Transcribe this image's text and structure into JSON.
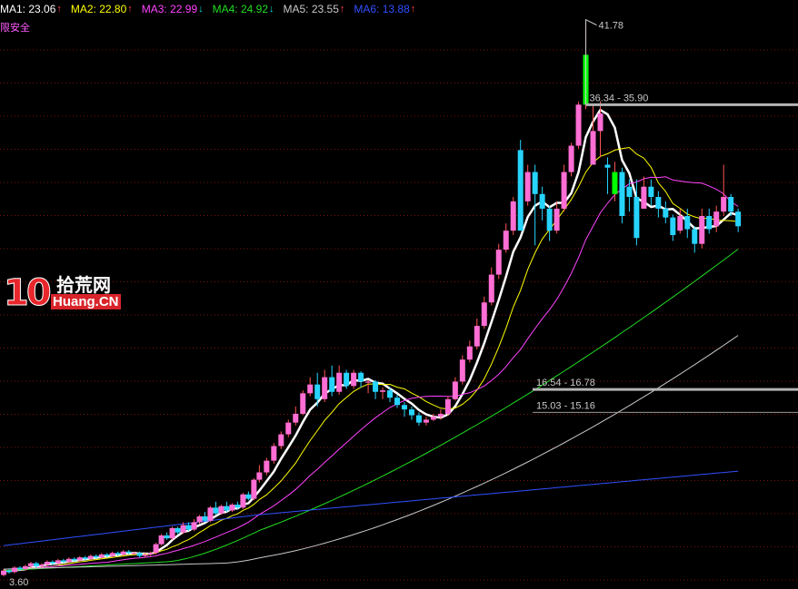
{
  "legend": [
    {
      "label": "MA1: 23.06",
      "color": "#ffffff",
      "arrow": "↑",
      "arrow_color": "#ff4040"
    },
    {
      "label": "MA2: 22.80",
      "color": "#ffff00",
      "arrow": "↑",
      "arrow_color": "#ff4040"
    },
    {
      "label": "MA3: 22.99",
      "color": "#ff44ff",
      "arrow": "↓",
      "arrow_color": "#00e0e0"
    },
    {
      "label": "MA4: 24.92",
      "color": "#22dd22",
      "arrow": "↓",
      "arrow_color": "#00e0e0"
    },
    {
      "label": "MA5: 23.55",
      "color": "#c8c8c8",
      "arrow": "↑",
      "arrow_color": "#ff4040"
    },
    {
      "label": "MA6: 13.88",
      "color": "#3050ff",
      "arrow": "↑",
      "arrow_color": "#ff4040"
    }
  ],
  "subtitle": "限安全",
  "logo": {
    "number": "10",
    "cn": "拾荒网",
    "en": "Huang.CN"
  },
  "chart_data": {
    "type": "candlestick",
    "ylim": [
      3.6,
      42.5
    ],
    "y_min_label": "3.60",
    "grid": "dotted-red",
    "annotations": [
      {
        "text": "41.78",
        "price": 41.78,
        "kind": "high"
      },
      {
        "text": "36.34 - 35.90",
        "price": 36.1,
        "kind": "band"
      },
      {
        "text": "16.54 - 16.78",
        "price": 16.66,
        "kind": "band"
      },
      {
        "text": "15.03 - 15.16",
        "price": 15.1,
        "kind": "band"
      }
    ],
    "colors": {
      "up": "#ff6ed4",
      "down": "#27d4ff",
      "highlight": "#00ff00",
      "wick": "#ff5555"
    },
    "candles": [
      [
        4.0,
        4.3,
        4.4,
        3.9
      ],
      [
        4.3,
        4.2,
        4.4,
        4.1
      ],
      [
        4.2,
        4.5,
        4.6,
        4.1
      ],
      [
        4.5,
        4.4,
        4.6,
        4.3
      ],
      [
        4.4,
        4.6,
        4.7,
        4.3
      ],
      [
        4.6,
        4.8,
        4.9,
        4.5
      ],
      [
        4.8,
        4.6,
        4.9,
        4.5
      ],
      [
        4.6,
        4.7,
        4.8,
        4.5
      ],
      [
        4.7,
        4.9,
        5.0,
        4.6
      ],
      [
        4.9,
        4.8,
        5.0,
        4.7
      ],
      [
        4.8,
        5.0,
        5.1,
        4.7
      ],
      [
        5.0,
        4.9,
        5.1,
        4.8
      ],
      [
        4.9,
        5.1,
        5.2,
        4.8
      ],
      [
        5.1,
        5.0,
        5.2,
        4.9
      ],
      [
        5.0,
        5.2,
        5.3,
        4.9
      ],
      [
        5.2,
        5.1,
        5.3,
        5.0
      ],
      [
        5.1,
        5.3,
        5.4,
        5.0
      ],
      [
        5.3,
        5.2,
        5.4,
        5.1
      ],
      [
        5.2,
        5.4,
        5.5,
        5.1
      ],
      [
        5.4,
        5.3,
        5.5,
        5.2
      ],
      [
        5.3,
        5.5,
        5.6,
        5.2
      ],
      [
        5.5,
        5.4,
        5.6,
        5.3
      ],
      [
        5.4,
        5.6,
        5.7,
        5.3
      ],
      [
        5.6,
        5.5,
        5.7,
        5.4
      ],
      [
        5.5,
        5.5,
        5.6,
        5.4
      ],
      [
        5.5,
        5.3,
        5.6,
        5.2
      ],
      [
        5.3,
        5.4,
        5.5,
        5.2
      ],
      [
        5.4,
        5.5,
        5.6,
        5.3
      ],
      [
        5.5,
        6.1,
        6.2,
        5.4
      ],
      [
        6.1,
        6.7,
        6.8,
        6.0
      ],
      [
        6.7,
        6.5,
        6.9,
        6.4
      ],
      [
        6.5,
        7.2,
        7.3,
        6.4
      ],
      [
        7.2,
        6.9,
        7.3,
        6.8
      ],
      [
        6.9,
        7.4,
        7.6,
        6.8
      ],
      [
        7.4,
        7.1,
        7.6,
        7.0
      ],
      [
        7.1,
        7.6,
        7.8,
        7.0
      ],
      [
        7.6,
        8.0,
        8.1,
        7.5
      ],
      [
        8.0,
        7.7,
        8.3,
        7.6
      ],
      [
        7.7,
        8.6,
        8.7,
        7.6
      ],
      [
        8.6,
        8.2,
        9.0,
        8.1
      ],
      [
        8.2,
        8.7,
        8.8,
        8.1
      ],
      [
        8.7,
        8.4,
        9.0,
        8.3
      ],
      [
        8.4,
        8.8,
        8.9,
        8.3
      ],
      [
        8.8,
        8.6,
        9.0,
        8.5
      ],
      [
        8.6,
        9.5,
        9.6,
        8.5
      ],
      [
        9.5,
        9.2,
        9.7,
        9.1
      ],
      [
        9.2,
        10.5,
        10.6,
        9.1
      ],
      [
        10.5,
        11.0,
        11.5,
        10.3
      ],
      [
        11.0,
        11.8,
        12.0,
        10.8
      ],
      [
        11.8,
        12.8,
        13.0,
        11.6
      ],
      [
        12.8,
        13.6,
        13.8,
        12.6
      ],
      [
        13.6,
        14.4,
        14.6,
        13.4
      ],
      [
        14.4,
        15.0,
        15.5,
        14.2
      ],
      [
        15.0,
        16.4,
        16.6,
        14.9
      ],
      [
        16.4,
        17.0,
        17.5,
        16.2
      ],
      [
        17.0,
        16.0,
        17.8,
        15.5
      ],
      [
        16.0,
        17.5,
        18.0,
        15.8
      ],
      [
        17.5,
        16.5,
        18.3,
        16.2
      ],
      [
        16.5,
        17.8,
        18.3,
        16.3
      ],
      [
        17.8,
        16.9,
        18.0,
        16.7
      ],
      [
        16.9,
        17.8,
        18.0,
        16.7
      ],
      [
        17.8,
        17.2,
        17.9,
        16.8
      ],
      [
        17.2,
        17.2,
        17.3,
        16.4
      ],
      [
        17.2,
        16.5,
        17.3,
        16.0
      ],
      [
        16.5,
        16.6,
        16.8,
        16.0
      ],
      [
        16.6,
        16.1,
        16.8,
        15.8
      ],
      [
        16.1,
        15.6,
        16.3,
        15.4
      ],
      [
        15.6,
        15.3,
        15.8,
        14.8
      ],
      [
        15.3,
        14.9,
        15.5,
        14.6
      ],
      [
        14.9,
        14.4,
        15.1,
        14.2
      ],
      [
        14.4,
        14.6,
        14.8,
        14.2
      ],
      [
        14.6,
        14.8,
        15.0,
        14.5
      ],
      [
        14.8,
        15.0,
        15.3,
        14.6
      ],
      [
        15.0,
        16.0,
        16.2,
        14.9
      ],
      [
        16.0,
        17.2,
        17.5,
        15.9
      ],
      [
        17.2,
        18.7,
        19.0,
        17.0
      ],
      [
        18.7,
        19.6,
        20.0,
        18.5
      ],
      [
        19.6,
        21.0,
        21.5,
        19.4
      ],
      [
        21.0,
        22.6,
        23.0,
        20.8
      ],
      [
        22.6,
        24.5,
        25.0,
        22.4
      ],
      [
        24.5,
        26.2,
        26.6,
        24.2
      ],
      [
        26.2,
        27.5,
        28.0,
        26.0
      ],
      [
        27.5,
        29.5,
        29.8,
        27.2
      ],
      [
        33.0,
        27.5,
        33.7,
        27.5
      ],
      [
        29.5,
        31.5,
        32.0,
        29.2
      ],
      [
        31.5,
        30.0,
        32.0,
        26.5
      ],
      [
        30.0,
        29.0,
        30.5,
        28.2
      ],
      [
        29.0,
        27.5,
        29.2,
        26.8
      ],
      [
        27.5,
        29.0,
        29.5,
        27.3
      ],
      [
        29.0,
        31.5,
        32.0,
        28.8
      ],
      [
        31.5,
        33.3,
        33.5,
        31.2
      ],
      [
        33.3,
        36.1,
        36.3,
        33.1
      ],
      [
        36.1,
        39.5,
        41.78,
        35.8
      ],
      [
        32.0,
        34.3,
        36.1,
        32.0
      ],
      [
        34.3,
        35.5,
        36.34,
        32.5
      ],
      [
        32.0,
        31.8,
        32.5,
        30.0
      ],
      [
        30.0,
        31.5,
        32.2,
        29.5
      ],
      [
        31.5,
        28.5,
        31.8,
        28.0
      ],
      [
        30.5,
        29.8,
        31.0,
        28.8
      ],
      [
        29.8,
        27.0,
        31.0,
        26.5
      ],
      [
        29.0,
        30.5,
        31.2,
        29.0
      ],
      [
        30.5,
        29.8,
        31.0,
        29.2
      ],
      [
        29.8,
        29.0,
        30.2,
        28.4
      ],
      [
        29.0,
        28.4,
        29.5,
        28.0
      ],
      [
        28.4,
        27.2,
        28.6,
        26.8
      ],
      [
        27.5,
        28.5,
        29.0,
        27.3
      ],
      [
        28.5,
        27.6,
        29.0,
        27.0
      ],
      [
        27.6,
        26.6,
        27.8,
        26.0
      ],
      [
        26.6,
        28.5,
        29.0,
        26.3
      ],
      [
        28.5,
        27.6,
        29.0,
        27.3
      ],
      [
        27.8,
        28.8,
        29.2,
        27.4
      ],
      [
        28.8,
        29.8,
        32.0,
        28.5
      ],
      [
        29.8,
        28.8,
        30.0,
        28.5
      ],
      [
        28.8,
        27.8,
        29.0,
        27.4
      ]
    ],
    "x_positions": [
      0,
      6,
      12,
      18,
      24,
      30,
      36,
      42,
      48,
      54,
      60,
      66,
      72,
      78,
      84,
      90,
      96,
      102,
      108,
      114,
      120,
      126,
      132,
      138,
      144,
      150,
      156,
      162,
      168,
      174,
      180,
      186,
      192,
      198,
      204,
      210,
      216,
      222,
      228,
      234,
      240,
      246,
      252,
      258,
      264,
      270,
      276,
      282,
      290,
      298,
      306,
      314,
      322,
      330,
      338,
      346,
      354,
      362,
      370,
      378,
      386,
      394,
      402,
      410,
      418,
      426,
      434,
      442,
      450,
      458,
      466,
      474,
      482,
      490,
      498,
      506,
      514,
      522,
      530,
      538,
      546,
      554,
      562,
      570,
      578,
      586,
      594,
      602,
      610,
      618,
      626,
      634,
      642,
      650,
      658,
      666,
      674,
      682,
      690,
      698,
      706,
      714,
      722,
      730,
      738,
      746,
      754,
      762,
      770,
      778,
      786,
      794,
      802,
      810,
      818,
      826,
      834,
      842,
      850,
      858,
      866,
      874
    ]
  }
}
